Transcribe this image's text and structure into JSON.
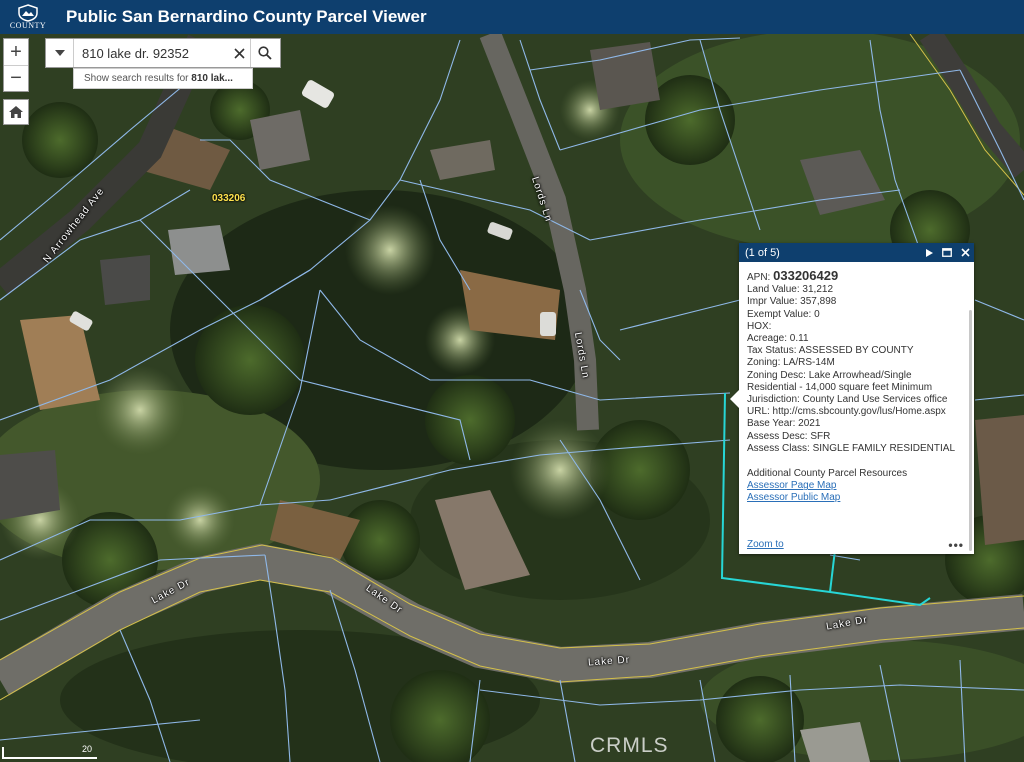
{
  "header": {
    "title": "Public San Bernardino County Parcel Viewer",
    "logo_text": "COUNTY",
    "color": "#0e3f6e"
  },
  "search": {
    "value": "810 lake dr. 92352",
    "suggestion_prefix": "Show search results for ",
    "suggestion_bold": "810 lak...",
    "icons": [
      "chevron-down-icon",
      "close-icon",
      "search-icon"
    ]
  },
  "controls": {
    "zoom_in": "+",
    "zoom_out": "−",
    "home_icon": "home-icon"
  },
  "map": {
    "parcel_book_label": "033206",
    "parcel_line_color": "#8fb8e8",
    "selected_parcel_color": "#27d6d6",
    "road_line_color": "#d4c04a",
    "streets": [
      "N Arrowhead Ave",
      "Lords Ln",
      "Lords Ln",
      "Lake Dr",
      "Lake Dr",
      "Lake Dr",
      "Lake Dr"
    ],
    "scale_label": "20"
  },
  "popup": {
    "count": "(1 of 5)",
    "apn_label": "APN: ",
    "apn_value": "033206429",
    "fields": [
      "Land Value: 31,212",
      "Impr Value: 357,898",
      "Exempt Value: 0",
      "HOX:",
      "Acreage: 0.11",
      "Tax Status: ASSESSED BY COUNTY",
      "Zoning: LA/RS-14M",
      "Zoning Desc: Lake Arrowhead/Single",
      "Residential - 14,000 square feet Minimum",
      "Jurisdiction: County Land Use Services office",
      "URL: http://cms.sbcounty.gov/lus/Home.aspx",
      "Base Year: 2021",
      "Assess Desc: SFR",
      "Assess Class: SINGLE FAMILY RESIDENTIAL"
    ],
    "resources_heading": "Additional County Parcel Resources",
    "links": [
      "Assessor Page Map",
      "Assessor Public Map"
    ],
    "zoom_to": "Zoom to",
    "more": "•••"
  },
  "watermark": "CRMLS"
}
